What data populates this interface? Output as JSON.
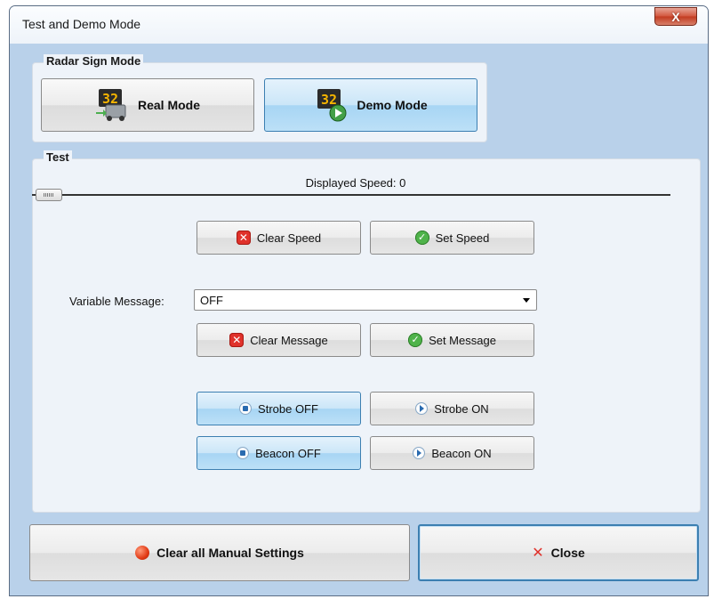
{
  "window": {
    "title": "Test and Demo Mode",
    "close_glyph": "X"
  },
  "radar_group": {
    "title": "Radar Sign Mode",
    "real_mode_label": "Real Mode",
    "demo_mode_label": "Demo Mode",
    "sign_digits": "32",
    "active_mode": "Demo Mode"
  },
  "test_group": {
    "title": "Test",
    "displayed_speed_text": "Displayed Speed: 0",
    "speed_value": 0,
    "clear_speed_label": "Clear Speed",
    "set_speed_label": "Set Speed",
    "variable_message_label": "Variable Message:",
    "variable_message_value": "OFF",
    "clear_message_label": "Clear Message",
    "set_message_label": "Set Message",
    "strobe_off_label": "Strobe OFF",
    "strobe_on_label": "Strobe ON",
    "beacon_off_label": "Beacon OFF",
    "beacon_on_label": "Beacon ON",
    "strobe_state": "OFF",
    "beacon_state": "OFF"
  },
  "footer": {
    "clear_all_label": "Clear all Manual Settings",
    "close_label": "Close"
  },
  "icons": {
    "clear": "x-red-square-icon",
    "set": "check-green-circle-icon",
    "off": "stop-radio-icon",
    "on": "play-radio-icon",
    "clear_all": "red-ball-icon",
    "close": "x-red-icon"
  },
  "colors": {
    "active_button": "#bce0f7",
    "accent_border": "#3c7fb1",
    "sign_digits": "#f4b400"
  }
}
